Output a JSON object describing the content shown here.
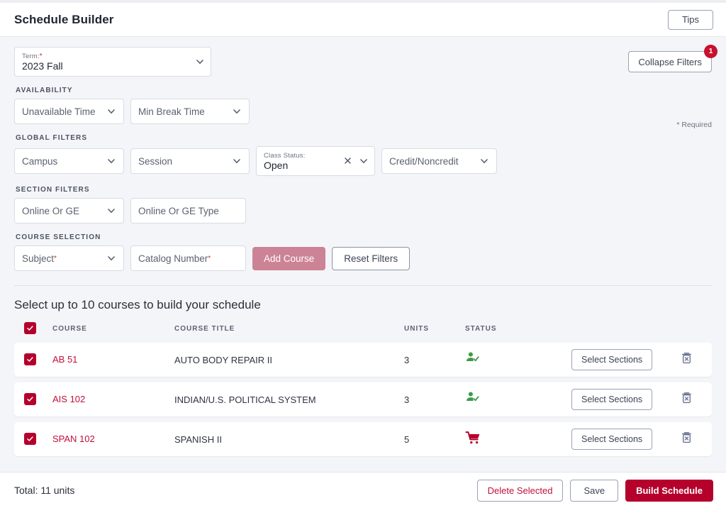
{
  "header": {
    "title": "Schedule Builder",
    "tips_label": "Tips"
  },
  "filters": {
    "term": {
      "label": "Term:",
      "required_mark": "*",
      "value": "2023 Fall"
    },
    "collapse_label": "Collapse Filters",
    "collapse_badge": "1",
    "required_note": "* Required",
    "availability": {
      "heading": "AVAILABILITY",
      "unavailable_time": "Unavailable Time",
      "min_break_time": "Min Break Time"
    },
    "global": {
      "heading": "GLOBAL FILTERS",
      "campus": "Campus",
      "session": "Session",
      "class_status_label": "Class Status:",
      "class_status_value": "Open",
      "credit_noncredit": "Credit/Noncredit"
    },
    "section": {
      "heading": "SECTION FILTERS",
      "online_or_ge": "Online Or GE",
      "online_or_ge_type": "Online Or GE Type"
    },
    "course_selection": {
      "heading": "COURSE SELECTION",
      "subject": "Subject",
      "subject_required": "*",
      "catalog_number": "Catalog Number",
      "catalog_required": "*",
      "add_course_label": "Add Course",
      "reset_filters_label": "Reset Filters"
    }
  },
  "course_list": {
    "title": "Select up to 10 courses to build your schedule",
    "columns": {
      "course": "COURSE",
      "course_title": "COURSE TITLE",
      "units": "UNITS",
      "status": "STATUS"
    },
    "select_sections_label": "Select Sections",
    "rows": [
      {
        "checked": true,
        "code": "AB 51",
        "title": "AUTO BODY REPAIR II",
        "units": "3",
        "status_icon": "enrolled-person-check-icon"
      },
      {
        "checked": true,
        "code": "AIS 102",
        "title": "INDIAN/U.S. POLITICAL SYSTEM",
        "units": "3",
        "status_icon": "enrolled-person-check-icon"
      },
      {
        "checked": true,
        "code": "SPAN 102",
        "title": "SPANISH II",
        "units": "5",
        "status_icon": "shopping-cart-icon"
      }
    ]
  },
  "footer": {
    "total": "Total: 11 units",
    "delete_selected_label": "Delete Selected",
    "save_label": "Save",
    "build_schedule_label": "Build Schedule"
  },
  "colors": {
    "brand_crimson": "#b5002c",
    "link_crimson": "#c0103a",
    "add_course_disabled": "#cc8396",
    "status_green": "#3f9a48",
    "badge_red": "#c8102e",
    "page_bg": "#f4f5f8"
  }
}
